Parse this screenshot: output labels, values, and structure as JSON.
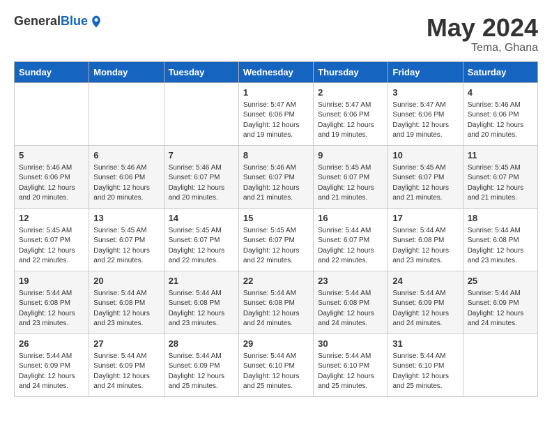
{
  "logo": {
    "general": "General",
    "blue": "Blue"
  },
  "title": "May 2024",
  "location": "Tema, Ghana",
  "days_of_week": [
    "Sunday",
    "Monday",
    "Tuesday",
    "Wednesday",
    "Thursday",
    "Friday",
    "Saturday"
  ],
  "weeks": [
    [
      {
        "day": "",
        "info": ""
      },
      {
        "day": "",
        "info": ""
      },
      {
        "day": "",
        "info": ""
      },
      {
        "day": "1",
        "info": "Sunrise: 5:47 AM\nSunset: 6:06 PM\nDaylight: 12 hours and 19 minutes."
      },
      {
        "day": "2",
        "info": "Sunrise: 5:47 AM\nSunset: 6:06 PM\nDaylight: 12 hours and 19 minutes."
      },
      {
        "day": "3",
        "info": "Sunrise: 5:47 AM\nSunset: 6:06 PM\nDaylight: 12 hours and 19 minutes."
      },
      {
        "day": "4",
        "info": "Sunrise: 5:46 AM\nSunset: 6:06 PM\nDaylight: 12 hours and 20 minutes."
      }
    ],
    [
      {
        "day": "5",
        "info": "Sunrise: 5:46 AM\nSunset: 6:06 PM\nDaylight: 12 hours and 20 minutes."
      },
      {
        "day": "6",
        "info": "Sunrise: 5:46 AM\nSunset: 6:06 PM\nDaylight: 12 hours and 20 minutes."
      },
      {
        "day": "7",
        "info": "Sunrise: 5:46 AM\nSunset: 6:07 PM\nDaylight: 12 hours and 20 minutes."
      },
      {
        "day": "8",
        "info": "Sunrise: 5:46 AM\nSunset: 6:07 PM\nDaylight: 12 hours and 21 minutes."
      },
      {
        "day": "9",
        "info": "Sunrise: 5:45 AM\nSunset: 6:07 PM\nDaylight: 12 hours and 21 minutes."
      },
      {
        "day": "10",
        "info": "Sunrise: 5:45 AM\nSunset: 6:07 PM\nDaylight: 12 hours and 21 minutes."
      },
      {
        "day": "11",
        "info": "Sunrise: 5:45 AM\nSunset: 6:07 PM\nDaylight: 12 hours and 21 minutes."
      }
    ],
    [
      {
        "day": "12",
        "info": "Sunrise: 5:45 AM\nSunset: 6:07 PM\nDaylight: 12 hours and 22 minutes."
      },
      {
        "day": "13",
        "info": "Sunrise: 5:45 AM\nSunset: 6:07 PM\nDaylight: 12 hours and 22 minutes."
      },
      {
        "day": "14",
        "info": "Sunrise: 5:45 AM\nSunset: 6:07 PM\nDaylight: 12 hours and 22 minutes."
      },
      {
        "day": "15",
        "info": "Sunrise: 5:45 AM\nSunset: 6:07 PM\nDaylight: 12 hours and 22 minutes."
      },
      {
        "day": "16",
        "info": "Sunrise: 5:44 AM\nSunset: 6:07 PM\nDaylight: 12 hours and 22 minutes."
      },
      {
        "day": "17",
        "info": "Sunrise: 5:44 AM\nSunset: 6:08 PM\nDaylight: 12 hours and 23 minutes."
      },
      {
        "day": "18",
        "info": "Sunrise: 5:44 AM\nSunset: 6:08 PM\nDaylight: 12 hours and 23 minutes."
      }
    ],
    [
      {
        "day": "19",
        "info": "Sunrise: 5:44 AM\nSunset: 6:08 PM\nDaylight: 12 hours and 23 minutes."
      },
      {
        "day": "20",
        "info": "Sunrise: 5:44 AM\nSunset: 6:08 PM\nDaylight: 12 hours and 23 minutes."
      },
      {
        "day": "21",
        "info": "Sunrise: 5:44 AM\nSunset: 6:08 PM\nDaylight: 12 hours and 23 minutes."
      },
      {
        "day": "22",
        "info": "Sunrise: 5:44 AM\nSunset: 6:08 PM\nDaylight: 12 hours and 24 minutes."
      },
      {
        "day": "23",
        "info": "Sunrise: 5:44 AM\nSunset: 6:08 PM\nDaylight: 12 hours and 24 minutes."
      },
      {
        "day": "24",
        "info": "Sunrise: 5:44 AM\nSunset: 6:09 PM\nDaylight: 12 hours and 24 minutes."
      },
      {
        "day": "25",
        "info": "Sunrise: 5:44 AM\nSunset: 6:09 PM\nDaylight: 12 hours and 24 minutes."
      }
    ],
    [
      {
        "day": "26",
        "info": "Sunrise: 5:44 AM\nSunset: 6:09 PM\nDaylight: 12 hours and 24 minutes."
      },
      {
        "day": "27",
        "info": "Sunrise: 5:44 AM\nSunset: 6:09 PM\nDaylight: 12 hours and 24 minutes."
      },
      {
        "day": "28",
        "info": "Sunrise: 5:44 AM\nSunset: 6:09 PM\nDaylight: 12 hours and 25 minutes."
      },
      {
        "day": "29",
        "info": "Sunrise: 5:44 AM\nSunset: 6:10 PM\nDaylight: 12 hours and 25 minutes."
      },
      {
        "day": "30",
        "info": "Sunrise: 5:44 AM\nSunset: 6:10 PM\nDaylight: 12 hours and 25 minutes."
      },
      {
        "day": "31",
        "info": "Sunrise: 5:44 AM\nSunset: 6:10 PM\nDaylight: 12 hours and 25 minutes."
      },
      {
        "day": "",
        "info": ""
      }
    ]
  ]
}
